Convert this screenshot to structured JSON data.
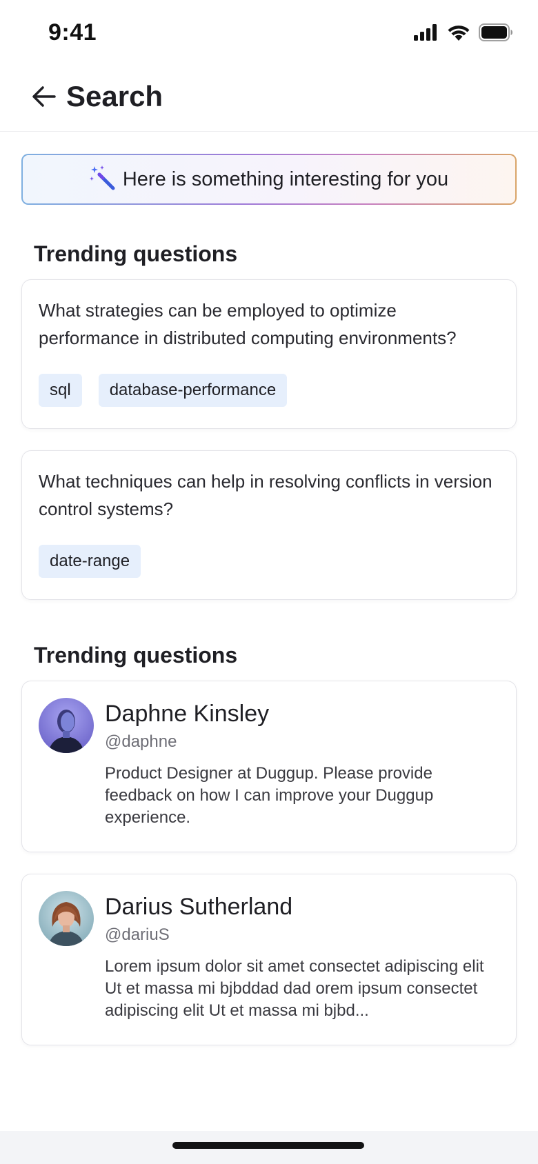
{
  "status_bar": {
    "time": "9:41",
    "icons": [
      "signal-icon",
      "wifi-icon",
      "battery-icon"
    ]
  },
  "header": {
    "back_icon": "arrow-left-icon",
    "title": "Search"
  },
  "banner": {
    "icon": "magic-wand-icon",
    "text": "Here is something interesting for you"
  },
  "questions_section": {
    "title": "Trending questions",
    "items": [
      {
        "text": "What strategies can be employed to optimize performance in distributed computing environments?",
        "tags": [
          "sql",
          "database-performance"
        ]
      },
      {
        "text": "What techniques can help in resolving conflicts in version control systems?",
        "tags": [
          "date-range"
        ]
      }
    ]
  },
  "people_section": {
    "title": "Trending questions",
    "items": [
      {
        "name": "Daphne Kinsley",
        "handle": "@daphne",
        "bio": "Product Designer at Duggup. Please provide feedback on how I can improve your Duggup experience."
      },
      {
        "name": "Darius Sutherland",
        "handle": "@dariuS",
        "bio": "Lorem ipsum dolor sit amet consectet adipiscing elit Ut et massa mi bjbddad dad orem ipsum consectet adipiscing elit Ut et massa mi bjbd..."
      }
    ]
  },
  "colors": {
    "tag_background": "#e6effc",
    "card_border": "#e3e3e8",
    "text_primary": "#1f1f24",
    "text_secondary": "#6e6e76",
    "banner_gradient": [
      "#7fb0e0",
      "#9f7ad8",
      "#c77fbf",
      "#d9a468"
    ]
  }
}
